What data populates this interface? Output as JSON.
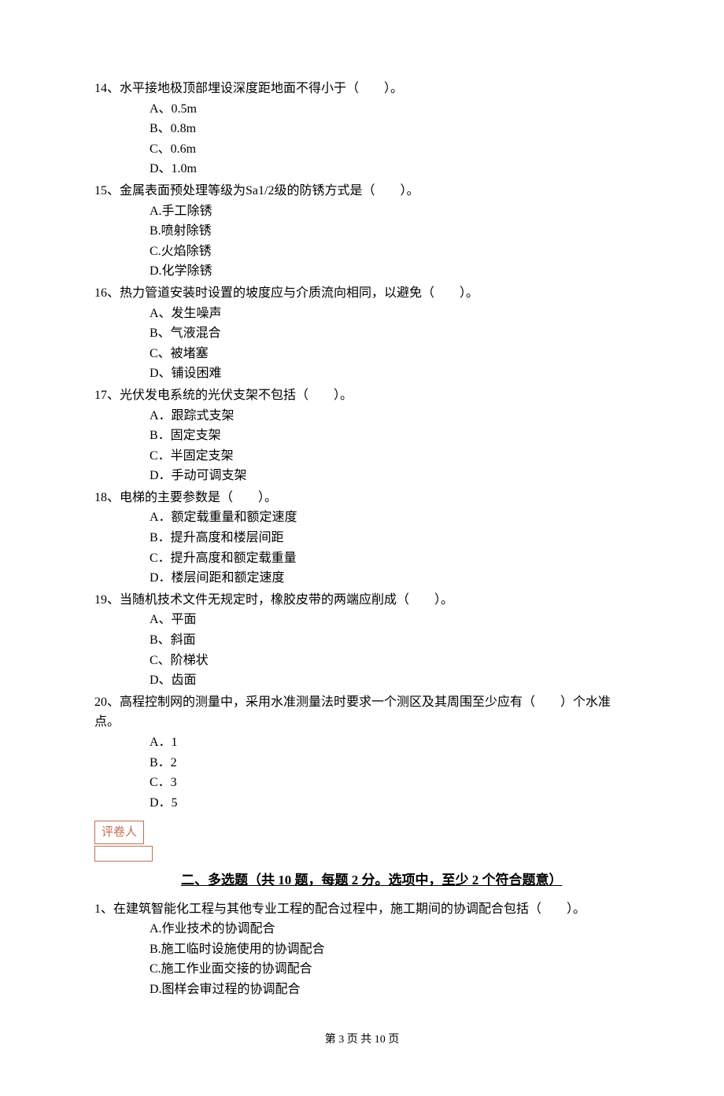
{
  "questions": [
    {
      "num": "14、",
      "text": "水平接地极顶部埋设深度距地面不得小于（　　）。",
      "opts": [
        "A、0.5m",
        "B、0.8m",
        "C、0.6m",
        "D、1.0m"
      ]
    },
    {
      "num": "15、",
      "text": "金属表面预处理等级为Sa1/2级的防锈方式是（　　）。",
      "opts": [
        "A.手工除锈",
        "B.喷射除锈",
        "C.火焰除锈",
        "D.化学除锈"
      ]
    },
    {
      "num": "16、",
      "text": "热力管道安装时设置的坡度应与介质流向相同，以避免（　　）。",
      "opts": [
        "A、发生噪声",
        "B、气液混合",
        "C、被堵塞",
        "D、铺设困难"
      ]
    },
    {
      "num": "17、",
      "text": "光伏发电系统的光伏支架不包括（　　）。",
      "opts": [
        "A．跟踪式支架",
        "B．固定支架",
        "C．半固定支架",
        "D．手动可调支架"
      ]
    },
    {
      "num": "18、",
      "text": "电梯的主要参数是（　　）。",
      "opts": [
        "A．额定载重量和额定速度",
        "B．提升高度和楼层间距",
        "C．提升高度和额定载重量",
        "D．楼层间距和额定速度"
      ]
    },
    {
      "num": "19、",
      "text": "当随机技术文件无规定时，橡胶皮带的两端应削成（　　）。",
      "opts": [
        "A、平面",
        "B、斜面",
        "C、阶梯状",
        "D、齿面"
      ]
    },
    {
      "num": "20、",
      "text": "高程控制网的测量中，采用水准测量法时要求一个测区及其周围至少应有（　　）个水准点。",
      "opts": [
        "A．1",
        "B．2",
        "C．3",
        "D．5"
      ]
    }
  ],
  "reviewer_label": "评卷人",
  "section2_heading": "二、多选题（共 10 题，每题 2 分。选项中，至少 2 个符合题意）",
  "multi_questions": [
    {
      "num": "1、",
      "text": "在建筑智能化工程与其他专业工程的配合过程中，施工期间的协调配合包括（　　）。",
      "opts": [
        "A.作业技术的协调配合",
        "B.施工临时设施使用的协调配合",
        "C.施工作业面交接的协调配合",
        "D.图样会审过程的协调配合"
      ]
    }
  ],
  "footer": "第 3 页 共 10 页"
}
